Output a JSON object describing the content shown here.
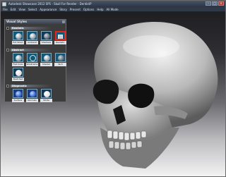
{
  "window": {
    "title": "Autodesk Showcase 2012 SP1 - Skull For Render - DentistP",
    "buttons": {
      "minimize": "–",
      "maximize": "□",
      "close": "×"
    }
  },
  "menubar": {
    "items": [
      "File",
      "Edit",
      "View",
      "Select",
      "Appearance",
      "Story",
      "Present",
      "Options",
      "Help",
      "All Mode"
    ]
  },
  "panel": {
    "title": "Visual Styles",
    "groups": [
      {
        "name": "Realistic",
        "items": [
          {
            "label": "Hot Shad.",
            "icon": "shaded-sphere-icon"
          },
          {
            "label": "Ambient",
            "icon": "ambient-sphere-icon"
          },
          {
            "label": "Shadows",
            "icon": "shadows-sphere-icon"
          },
          {
            "label": "Realistic",
            "icon": "realistic-cube-icon",
            "selected": true
          },
          {
            "label": "Ray Trace",
            "icon": "raytrace-sphere-icon"
          }
        ]
      },
      {
        "name": "Abstract",
        "items": [
          {
            "label": "Flat Color",
            "icon": "flat-color-sphere-icon"
          },
          {
            "label": "Wireframe",
            "icon": "wireframe-sphere-icon"
          },
          {
            "label": "Shaded",
            "icon": "shaded-abstract-icon"
          },
          {
            "label": "Tech",
            "icon": "tech-sphere-icon"
          },
          {
            "label": "Sketch",
            "icon": "sketch-sphere-icon"
          },
          {
            "label": "Sketched",
            "icon": "sketched-sphere-icon"
          }
        ]
      },
      {
        "name": "Diagnostic",
        "items": [
          {
            "label": "Surface",
            "icon": "surface-sphere-icon"
          },
          {
            "label": "Normals",
            "icon": "normals-sphere-icon"
          },
          {
            "label": "White",
            "icon": "white-sphere-icon"
          }
        ]
      }
    ]
  },
  "colors": {
    "selection_highlight": "#e0281e",
    "titlebar": "#2b3441",
    "panel": "#3c3c3c"
  }
}
